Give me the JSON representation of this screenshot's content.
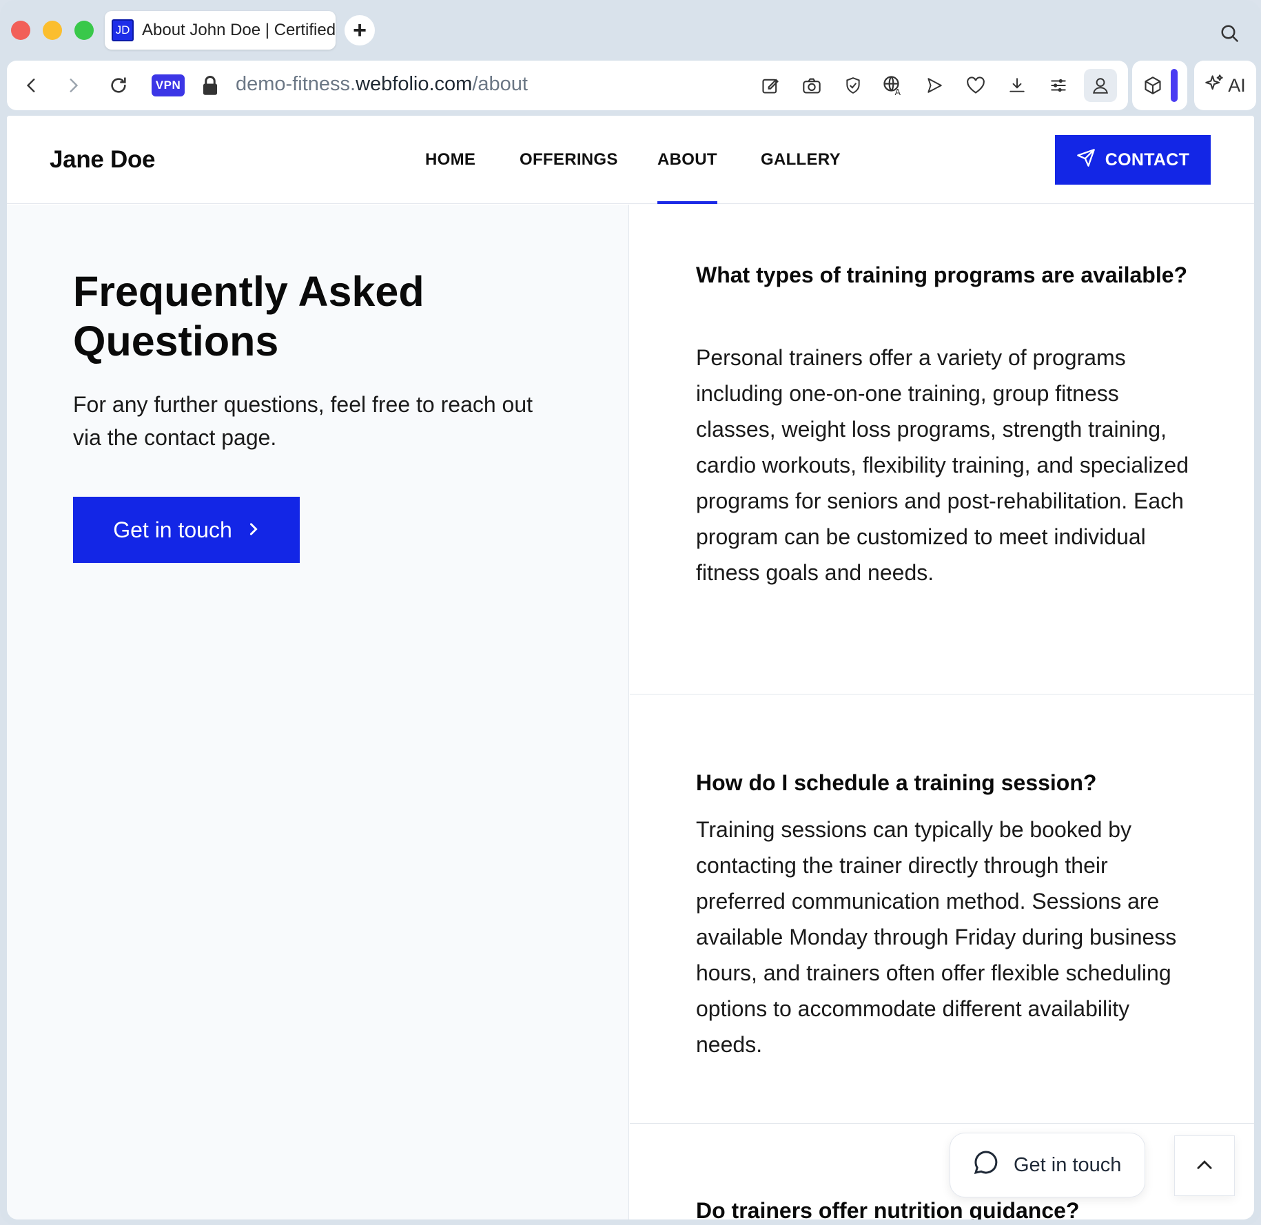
{
  "browser": {
    "tab_favicon": "JD",
    "tab_title": "About John Doe | Certified Personal Trainer",
    "new_tab_symbol": "+",
    "vpn_label": "VPN",
    "url_prefix": "demo-fitness.",
    "url_domain": "webfolio.com",
    "url_path": "/about",
    "ai_label": "AI",
    "accent_color": "#4a3cf2"
  },
  "nav": {
    "brand": "Jane Doe",
    "items": [
      {
        "label": "HOME"
      },
      {
        "label": "OFFERINGS"
      },
      {
        "label": "ABOUT"
      },
      {
        "label": "GALLERY"
      }
    ],
    "active": "ABOUT",
    "contact_label": "CONTACT",
    "brand_color": "#1326e6"
  },
  "intro": {
    "title": "Frequently Asked Questions",
    "subtitle": "For any further questions, feel free to reach out via the contact page.",
    "button_label": "Get in touch"
  },
  "faq": [
    {
      "question": "What types of training programs are available?",
      "answer": "Personal trainers offer a variety of programs including one-on-one training, group fitness classes, weight loss programs, strength training, cardio workouts, flexibility training, and specialized programs for seniors and post-rehabilitation. Each program can be customized to meet individual fitness goals and needs."
    },
    {
      "question": "How do I schedule a training session?",
      "answer": "Training sessions can typically be booked by contacting the trainer directly through their preferred communication method. Sessions are available Monday through Friday during business hours, and trainers often offer flexible scheduling options to accommodate different availability needs."
    },
    {
      "question": "Do trainers offer nutrition guidance?",
      "answer": ""
    }
  ],
  "floating": {
    "chat_label": "Get in touch"
  }
}
